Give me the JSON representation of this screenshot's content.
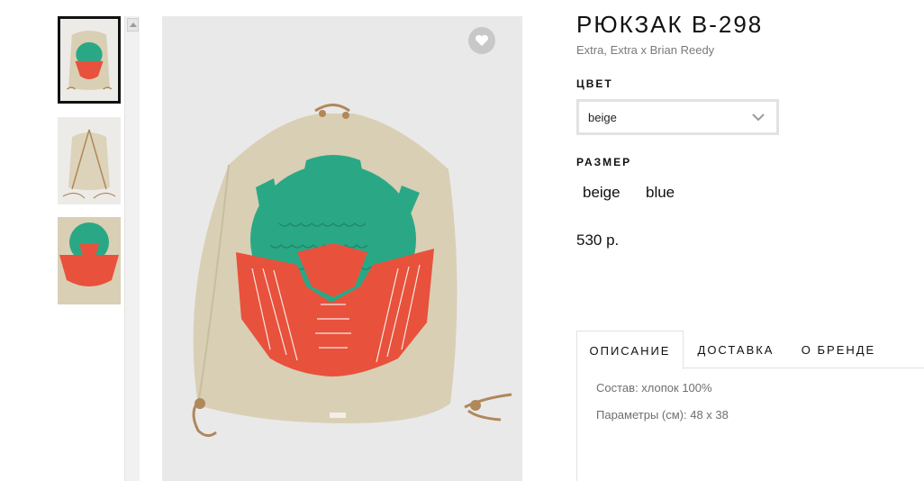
{
  "product": {
    "title": "РЮКЗАК B-298",
    "subtitle": "Extra, Extra x Brian Reedy",
    "price": "530 р."
  },
  "color": {
    "label": "ЦВЕТ",
    "selected": "beige"
  },
  "size": {
    "label": "РАЗМЕР",
    "options": [
      "beige",
      "blue"
    ]
  },
  "tabs": [
    {
      "label": "ОПИСАНИЕ",
      "active": true
    },
    {
      "label": "ДОСТАВКА",
      "active": false
    },
    {
      "label": "О БРЕНДЕ",
      "active": false
    }
  ],
  "description": {
    "composition": "Состав: хлопок 100%",
    "dimensions": "Параметры (см): 48 x 38"
  },
  "colors": {
    "bag": "#d9cfb4",
    "green_print": "#2aa886",
    "red_print": "#e8513c",
    "cord": "#b0885a",
    "fav_bg": "#c8c8c8"
  },
  "icons": {
    "favorite": "heart-icon",
    "dropdown": "chevron-down-icon",
    "scroll": "scroll-up-arrow-icon"
  }
}
